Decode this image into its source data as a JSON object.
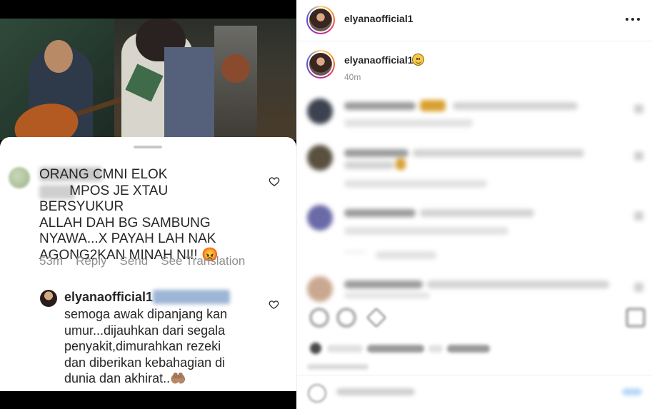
{
  "left_panel": {
    "comment": {
      "text": "ORANG CMNI ELOK\n        MPOS JE XTAU BERSYUKUR\nALLAH DAH BG SAMBUNG\nNYAWA...X PAYAH LAH NAK\nAGONG2KAN MINAH NI!! 😡",
      "time": "53m",
      "reply_label": "Reply",
      "send_label": "Send",
      "translate_label": "See Translation"
    },
    "reply": {
      "username": "elyanaofficial1",
      "text": "semoga awak dipanjang kan\numur...dijauhkan dari segala\npenyakit,dimurahkan rezeki\ndan diberikan kebahagian di\ndunia dan akhirat..🤲🏽"
    }
  },
  "post": {
    "header_username": "elyanaofficial1",
    "caption_username": "elyanaofficial1",
    "caption_time": "40m",
    "icons": {
      "more": "more-horizontal-icon",
      "caption_emoji": "slightly-smiling-face-icon"
    }
  },
  "colors": {
    "text": "#262626",
    "muted": "#8e8e8e",
    "story_ring_start": "#feda75",
    "story_ring_end": "#962fbf"
  }
}
